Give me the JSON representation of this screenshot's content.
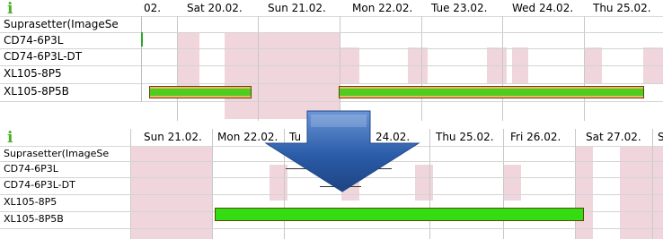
{
  "top_panel": {
    "info_icon": "i",
    "days": [
      "02.",
      "Sat 20.02.",
      "Sun 21.02.",
      "Mon 22.02.",
      "Tue 23.02.",
      "Wed 24.02.",
      "Thu 25.02."
    ],
    "rows": [
      "Suprasetter(ImageSe",
      "CD74-6P3L",
      "CD74-6P3L-DT",
      "XL105-8P5",
      "XL105-8P5B"
    ]
  },
  "bottom_panel": {
    "info_icon": "i",
    "days": [
      "Sun 21.02.",
      "Mon 22.02.",
      "Tu",
      "24.02.",
      "Thu 25.02.",
      "Fri 26.02.",
      "Sat 27.02.",
      "S"
    ],
    "rows": [
      "Suprasetter(ImageSe",
      "CD74-6P3L",
      "CD74-6P3L-DT",
      "XL105-8P5",
      "XL105-8P5B"
    ]
  },
  "icons": {
    "transition_arrow": "down-arrow-icon",
    "info": "info-icon"
  },
  "colors": {
    "weekend_shade": "#f0d6dc",
    "bar_green": "#33dd11",
    "bar_orange": "#f4b26d",
    "arrow_blue": "#2a5ca8"
  }
}
